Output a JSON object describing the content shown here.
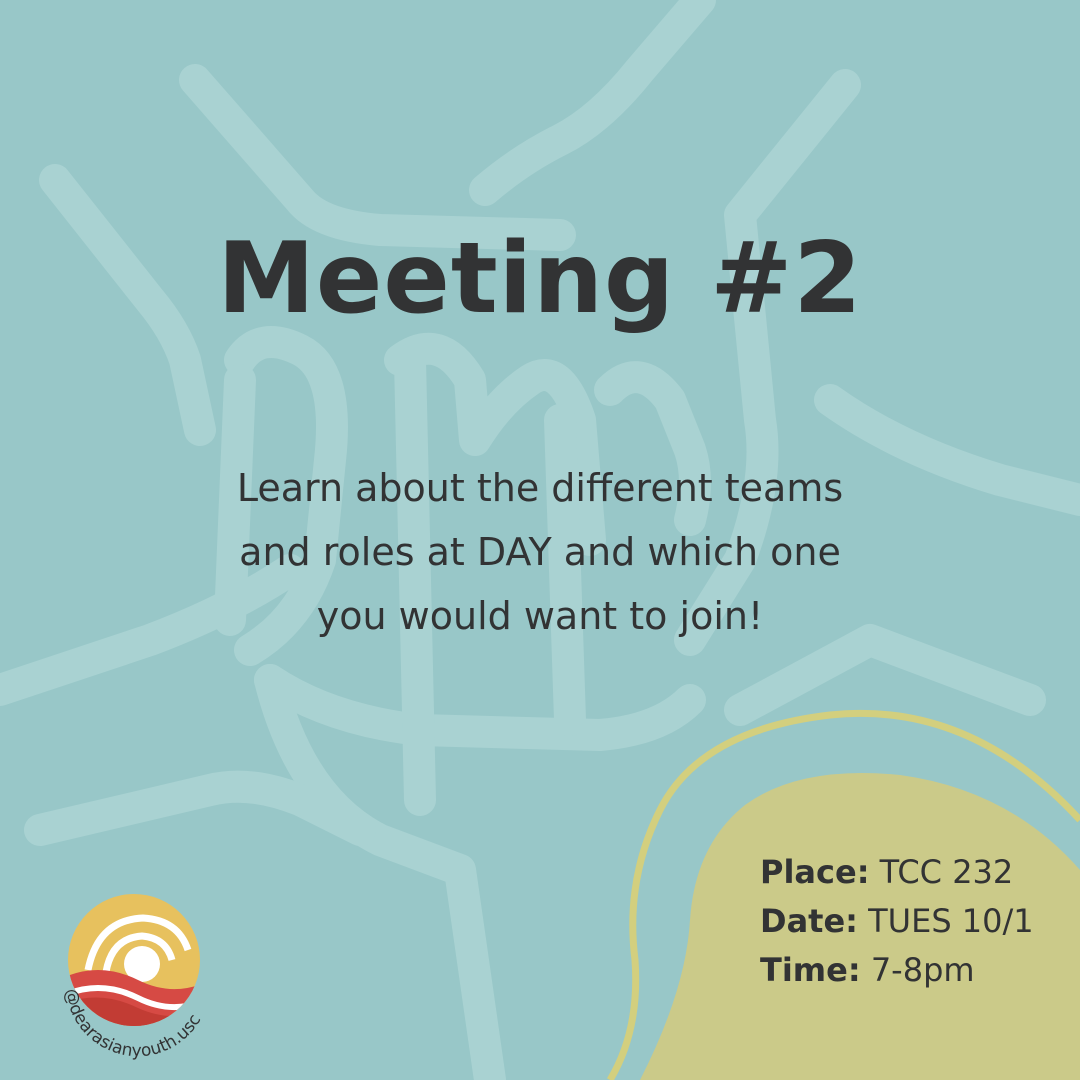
{
  "title": "Meeting #2",
  "description_lines": [
    "Learn about the different teams",
    "and roles at DAY and which one",
    "you would want to join!"
  ],
  "details": {
    "place_label": "Place:",
    "place_value": "TCC 232",
    "date_label": "Date:",
    "date_value": "TUES 10/1",
    "time_label": "Time:",
    "time_value": "7-8pm"
  },
  "logo": {
    "handle": "@dearasianyouth.usc"
  },
  "colors": {
    "background": "#98c7c8",
    "hand_lines": "#a9d2d2",
    "blob_fill": "#cbca89",
    "blob_outline": "#d3cf7e",
    "text": "#323334",
    "logo_gold": "#e7c15e",
    "logo_red": "#d64a44",
    "logo_dark_red": "#c23c34"
  }
}
